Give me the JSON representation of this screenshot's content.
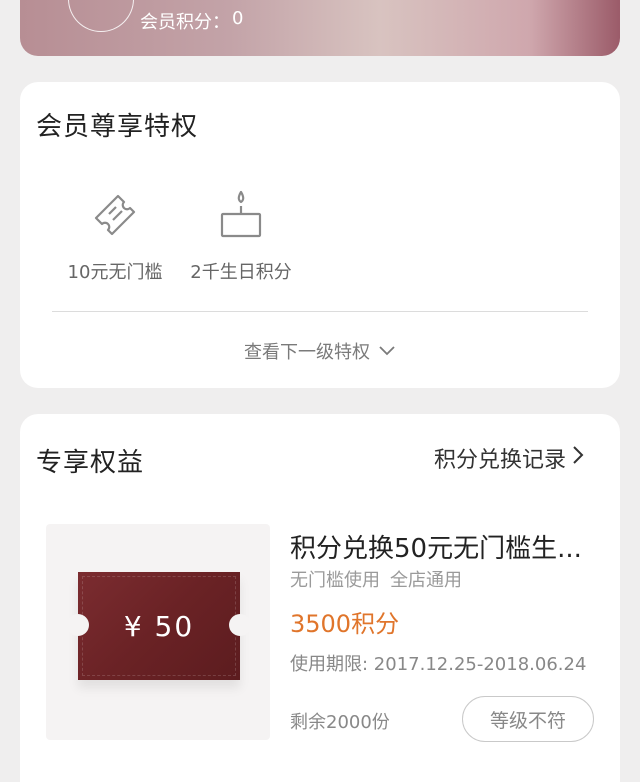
{
  "member_card": {
    "points_label": "会员积分：",
    "points_value": "0"
  },
  "privileges": {
    "title": "会员尊享特权",
    "items": [
      {
        "icon": "ticket-icon",
        "label": "10元无门槛"
      },
      {
        "icon": "birthday-cake-icon",
        "label": "2千生日积分"
      }
    ],
    "see_next_label": "查看下一级特权"
  },
  "benefits": {
    "title": "专享权益",
    "records_link": "积分兑换记录",
    "item": {
      "coupon_text": "¥ 50",
      "title": "积分兑换50元无门槛生...",
      "tags": [
        "无门槛使用",
        "全店通用"
      ],
      "points": "3500积分",
      "validity": "使用期限: 2017.12.25-2018.06.24",
      "stock": "剩余2000份",
      "button_label": "等级不符"
    }
  },
  "colors": {
    "accent_orange": "#e0752b",
    "coupon_red": "#6a2225",
    "page_bg": "#efeeee"
  }
}
